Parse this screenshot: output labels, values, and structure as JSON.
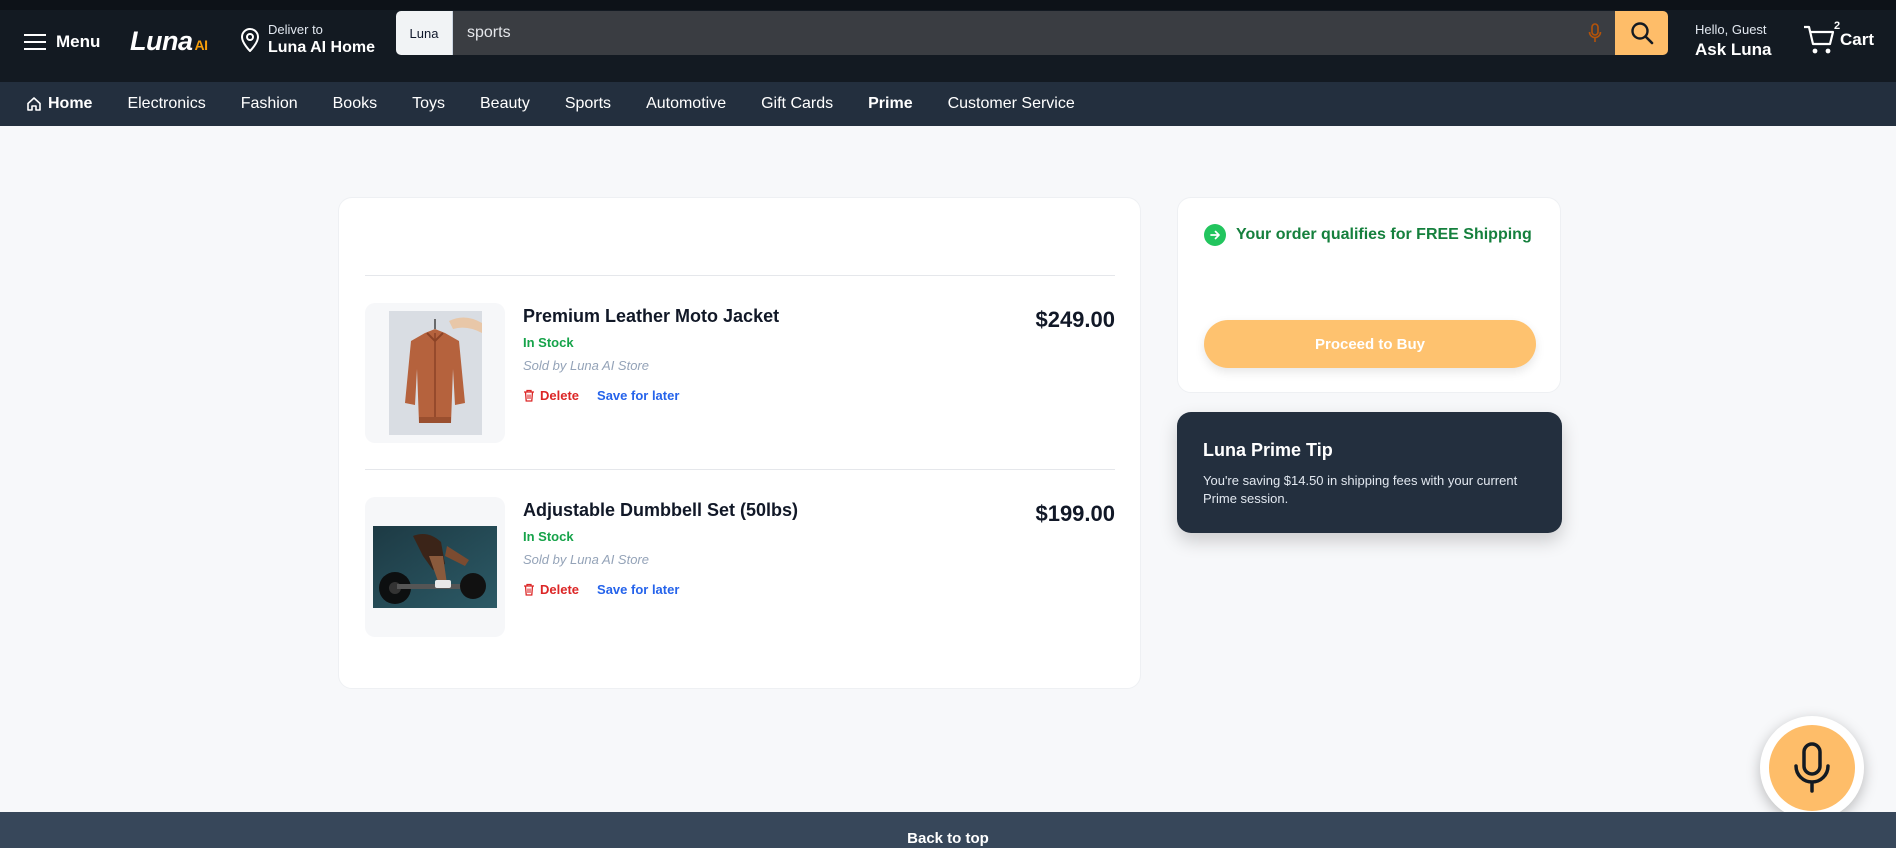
{
  "header": {
    "menu_label": "Menu",
    "logo_text": "Luna",
    "logo_suffix": "AI",
    "deliver_label": "Deliver to",
    "deliver_location": "Luna AI Home",
    "search_scope": "Luna",
    "search_value": "sports",
    "account_greeting": "Hello, Guest",
    "account_action": "Ask Luna",
    "cart_count": "2",
    "cart_label": "Cart"
  },
  "nav": {
    "items": [
      {
        "label": "Home"
      },
      {
        "label": "Electronics"
      },
      {
        "label": "Fashion"
      },
      {
        "label": "Books"
      },
      {
        "label": "Toys"
      },
      {
        "label": "Beauty"
      },
      {
        "label": "Sports"
      },
      {
        "label": "Automotive"
      },
      {
        "label": "Gift Cards"
      },
      {
        "label": "Prime"
      },
      {
        "label": "Customer Service"
      }
    ]
  },
  "cart_items": [
    {
      "title": "Premium Leather Moto Jacket",
      "stock": "In Stock",
      "seller": "Sold by Luna AI Store",
      "delete_label": "Delete",
      "save_label": "Save for later",
      "price": "$249.00"
    },
    {
      "title": "Adjustable Dumbbell Set (50lbs)",
      "stock": "In Stock",
      "seller": "Sold by Luna AI Store",
      "delete_label": "Delete",
      "save_label": "Save for later",
      "price": "$199.00"
    }
  ],
  "summary": {
    "free_shipping": "Your order qualifies for FREE Shipping",
    "proceed_label": "Proceed to Buy"
  },
  "tip": {
    "title": "Luna Prime Tip",
    "body": "You're saving $14.50 in shipping fees with your current Prime session."
  },
  "footer": {
    "back_to_top": "Back to top"
  },
  "colors": {
    "header_bg": "#131a22",
    "nav_bg": "#232f3e",
    "accent": "#febd69",
    "in_stock": "#16a34a",
    "delete": "#dc2626",
    "link": "#2563eb"
  }
}
